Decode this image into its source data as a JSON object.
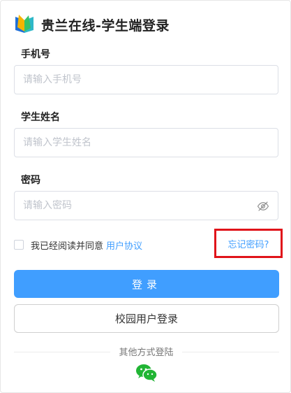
{
  "header": {
    "title": "贵兰在线-学生端登录",
    "logo_icon": "open-book-logo"
  },
  "form": {
    "phone": {
      "label": "手机号",
      "placeholder": "请输入手机号"
    },
    "name": {
      "label": "学生姓名",
      "placeholder": "请输入学生姓名"
    },
    "password": {
      "label": "密码",
      "placeholder": "请输入密码",
      "toggle_icon": "eye-off-icon"
    }
  },
  "agreement": {
    "text": "我已经阅读并同意",
    "link": "用户协议",
    "checked": false
  },
  "forgot": {
    "label": "忘记密码?"
  },
  "buttons": {
    "login": "登录",
    "campus_login": "校园用户登录"
  },
  "other": {
    "label": "其他方式登陆",
    "wechat_icon": "wechat-icon"
  },
  "colors": {
    "primary": "#409eff",
    "highlight_border": "#e0141a"
  }
}
